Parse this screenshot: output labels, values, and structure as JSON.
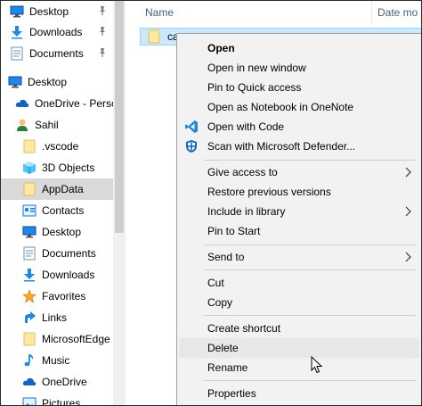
{
  "nav": {
    "items": [
      {
        "label": "Desktop",
        "icon": "desktop-icon",
        "pinned": true
      },
      {
        "label": "Downloads",
        "icon": "downloads-icon",
        "pinned": true
      },
      {
        "label": "Documents",
        "icon": "documents-icon",
        "pinned": true
      },
      {
        "label": "Desktop",
        "icon": "desktop-icon"
      },
      {
        "label": "OneDrive - Perso",
        "icon": "onedrive-icon"
      },
      {
        "label": "Sahil",
        "icon": "user-icon"
      },
      {
        "label": ".vscode",
        "icon": "folder-icon"
      },
      {
        "label": "3D Objects",
        "icon": "3d-objects-icon"
      },
      {
        "label": "AppData",
        "icon": "folder-icon",
        "selected": true
      },
      {
        "label": "Contacts",
        "icon": "contacts-icon"
      },
      {
        "label": "Desktop",
        "icon": "desktop-icon"
      },
      {
        "label": "Documents",
        "icon": "documents-icon"
      },
      {
        "label": "Downloads",
        "icon": "downloads-icon"
      },
      {
        "label": "Favorites",
        "icon": "favorites-star-icon"
      },
      {
        "label": "Links",
        "icon": "links-arrow-icon"
      },
      {
        "label": "MicrosoftEdge",
        "icon": "folder-icon"
      },
      {
        "label": "Music",
        "icon": "music-icon"
      },
      {
        "label": "OneDrive",
        "icon": "onedrive-icon"
      },
      {
        "label": "Pictures",
        "icon": "pictures-icon"
      }
    ]
  },
  "content": {
    "columns": {
      "name": "Name",
      "date": "Date mo"
    },
    "file": {
      "name": "ca"
    }
  },
  "context_menu": {
    "items": [
      {
        "label": "Open",
        "bold": true
      },
      {
        "label": "Open in new window"
      },
      {
        "label": "Pin to Quick access"
      },
      {
        "label": "Open as Notebook in OneNote"
      },
      {
        "label": "Open with Code",
        "icon": "vscode-icon"
      },
      {
        "label": "Scan with Microsoft Defender...",
        "icon": "defender-shield-icon"
      },
      {
        "label": "Give access to",
        "submenu": true
      },
      {
        "label": "Restore previous versions"
      },
      {
        "label": "Include in library",
        "submenu": true
      },
      {
        "label": "Pin to Start"
      },
      {
        "label": "Send to",
        "submenu": true
      },
      {
        "label": "Cut"
      },
      {
        "label": "Copy"
      },
      {
        "label": "Create shortcut"
      },
      {
        "label": "Delete",
        "hovered": true
      },
      {
        "label": "Rename"
      },
      {
        "label": "Properties"
      }
    ]
  },
  "colors": {
    "selection": "#cce8ff",
    "menu_bg": "#f2f2f2",
    "nav_selected": "#d9d9d9",
    "header_text": "#4c607a"
  }
}
